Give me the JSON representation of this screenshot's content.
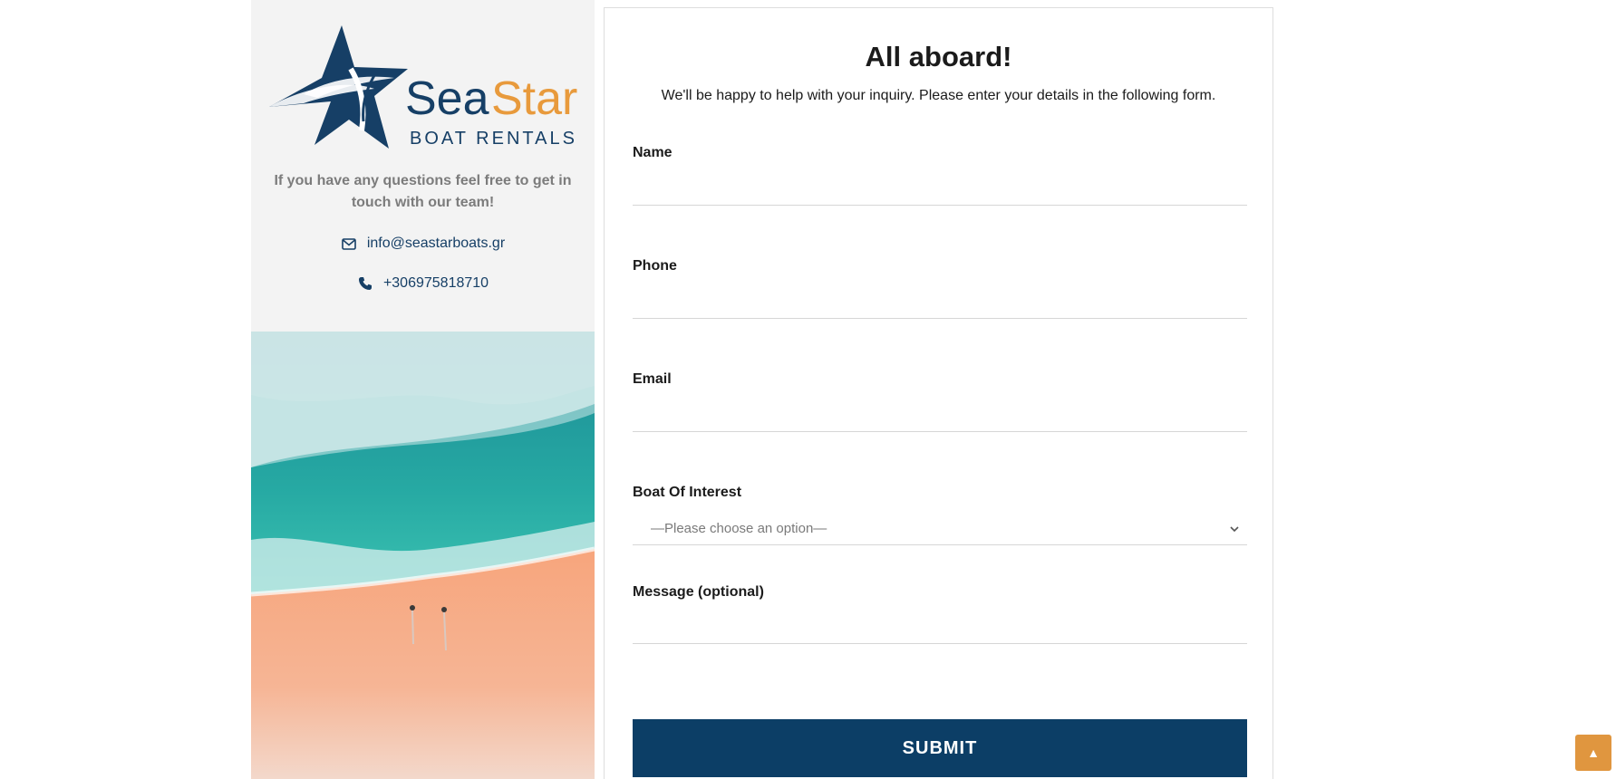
{
  "brand": {
    "name_part1": "Sea",
    "name_part2": "Star",
    "subtitle": "BOAT RENTALS",
    "color_dark": "#163f66",
    "color_accent": "#e89a3c"
  },
  "sidebar": {
    "tagline": "If you have any questions feel free to get in touch with our team!",
    "email": "info@seastarboats.gr",
    "email_icon": "envelope-icon",
    "phone": "+306975818710",
    "phone_icon": "phone-icon"
  },
  "form": {
    "title": "All aboard!",
    "subtitle": "We'll be happy to help with your inquiry. Please enter your details in the following form.",
    "fields": {
      "name_label": "Name",
      "name_value": "",
      "phone_label": "Phone",
      "phone_value": "",
      "email_label": "Email",
      "email_value": "",
      "boat_label": "Boat Of Interest",
      "boat_selected": "—Please choose an option—",
      "message_label": "Message (optional)",
      "message_value": ""
    },
    "submit_label": "SUBMIT",
    "submit_color": "#0c3e66"
  },
  "back_to_top": {
    "label": "▲",
    "color": "#e0963f"
  }
}
